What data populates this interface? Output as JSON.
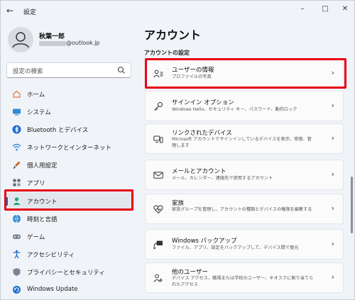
{
  "window": {
    "title": "設定",
    "back": "←",
    "minimize": "–",
    "maximize": "□",
    "close": "✕"
  },
  "user": {
    "name": "秋葉一郎",
    "email_visible": "@outlook.jp"
  },
  "search": {
    "placeholder": "設定の検索"
  },
  "sidebar": {
    "items": [
      {
        "label": "ホーム",
        "icon": "home-icon"
      },
      {
        "label": "システム",
        "icon": "monitor-icon"
      },
      {
        "label": "Bluetooth とデバイス",
        "icon": "bluetooth-icon"
      },
      {
        "label": "ネットワークとインターネット",
        "icon": "wifi-icon"
      },
      {
        "label": "個人用設定",
        "icon": "brush-icon"
      },
      {
        "label": "アプリ",
        "icon": "apps-icon"
      },
      {
        "label": "アカウント",
        "icon": "person-icon",
        "active": true
      },
      {
        "label": "時刻と言語",
        "icon": "globe-clock-icon"
      },
      {
        "label": "ゲーム",
        "icon": "gamepad-icon"
      },
      {
        "label": "アクセシビリティ",
        "icon": "accessibility-icon"
      },
      {
        "label": "プライバシーとセキュリティ",
        "icon": "shield-icon"
      },
      {
        "label": "Windows Update",
        "icon": "update-icon"
      }
    ]
  },
  "main": {
    "title": "アカウント",
    "section": "アカウントの設定",
    "cards": [
      {
        "title": "ユーザーの情報",
        "sub": "プロファイルの写真",
        "icon": "user-info-icon"
      },
      {
        "title": "サインイン オプション",
        "sub": "Windows Hello、セキュリティ キー、パスワード、動的ロック",
        "icon": "key-icon"
      },
      {
        "title": "リンクされたデバイス",
        "sub": "Microsoft アカウントでサインインしているデバイスを表示、修復、管理します",
        "icon": "linked-devices-icon"
      },
      {
        "title": "メールとアカウント",
        "sub": "メール、カレンダー、連絡先で使用するアカウント",
        "icon": "mail-icon"
      },
      {
        "title": "家族",
        "sub": "家族グループを管理し、アカウントの種類とデバイスの権限を編集する",
        "icon": "heart-icon"
      },
      {
        "title": "Windows バックアップ",
        "sub": "ファイル、アプリ、設定をバックアップして、デバイス間で復元",
        "icon": "backup-icon"
      },
      {
        "title": "他のユーザー",
        "sub": "デバイス アクセス、職場または学校のユーザー、キオスクに割り当てられたアクセス",
        "icon": "other-users-icon"
      }
    ],
    "chevron": "›"
  },
  "colors": {
    "accent": "#0067c0",
    "highlight": "#e60012"
  }
}
